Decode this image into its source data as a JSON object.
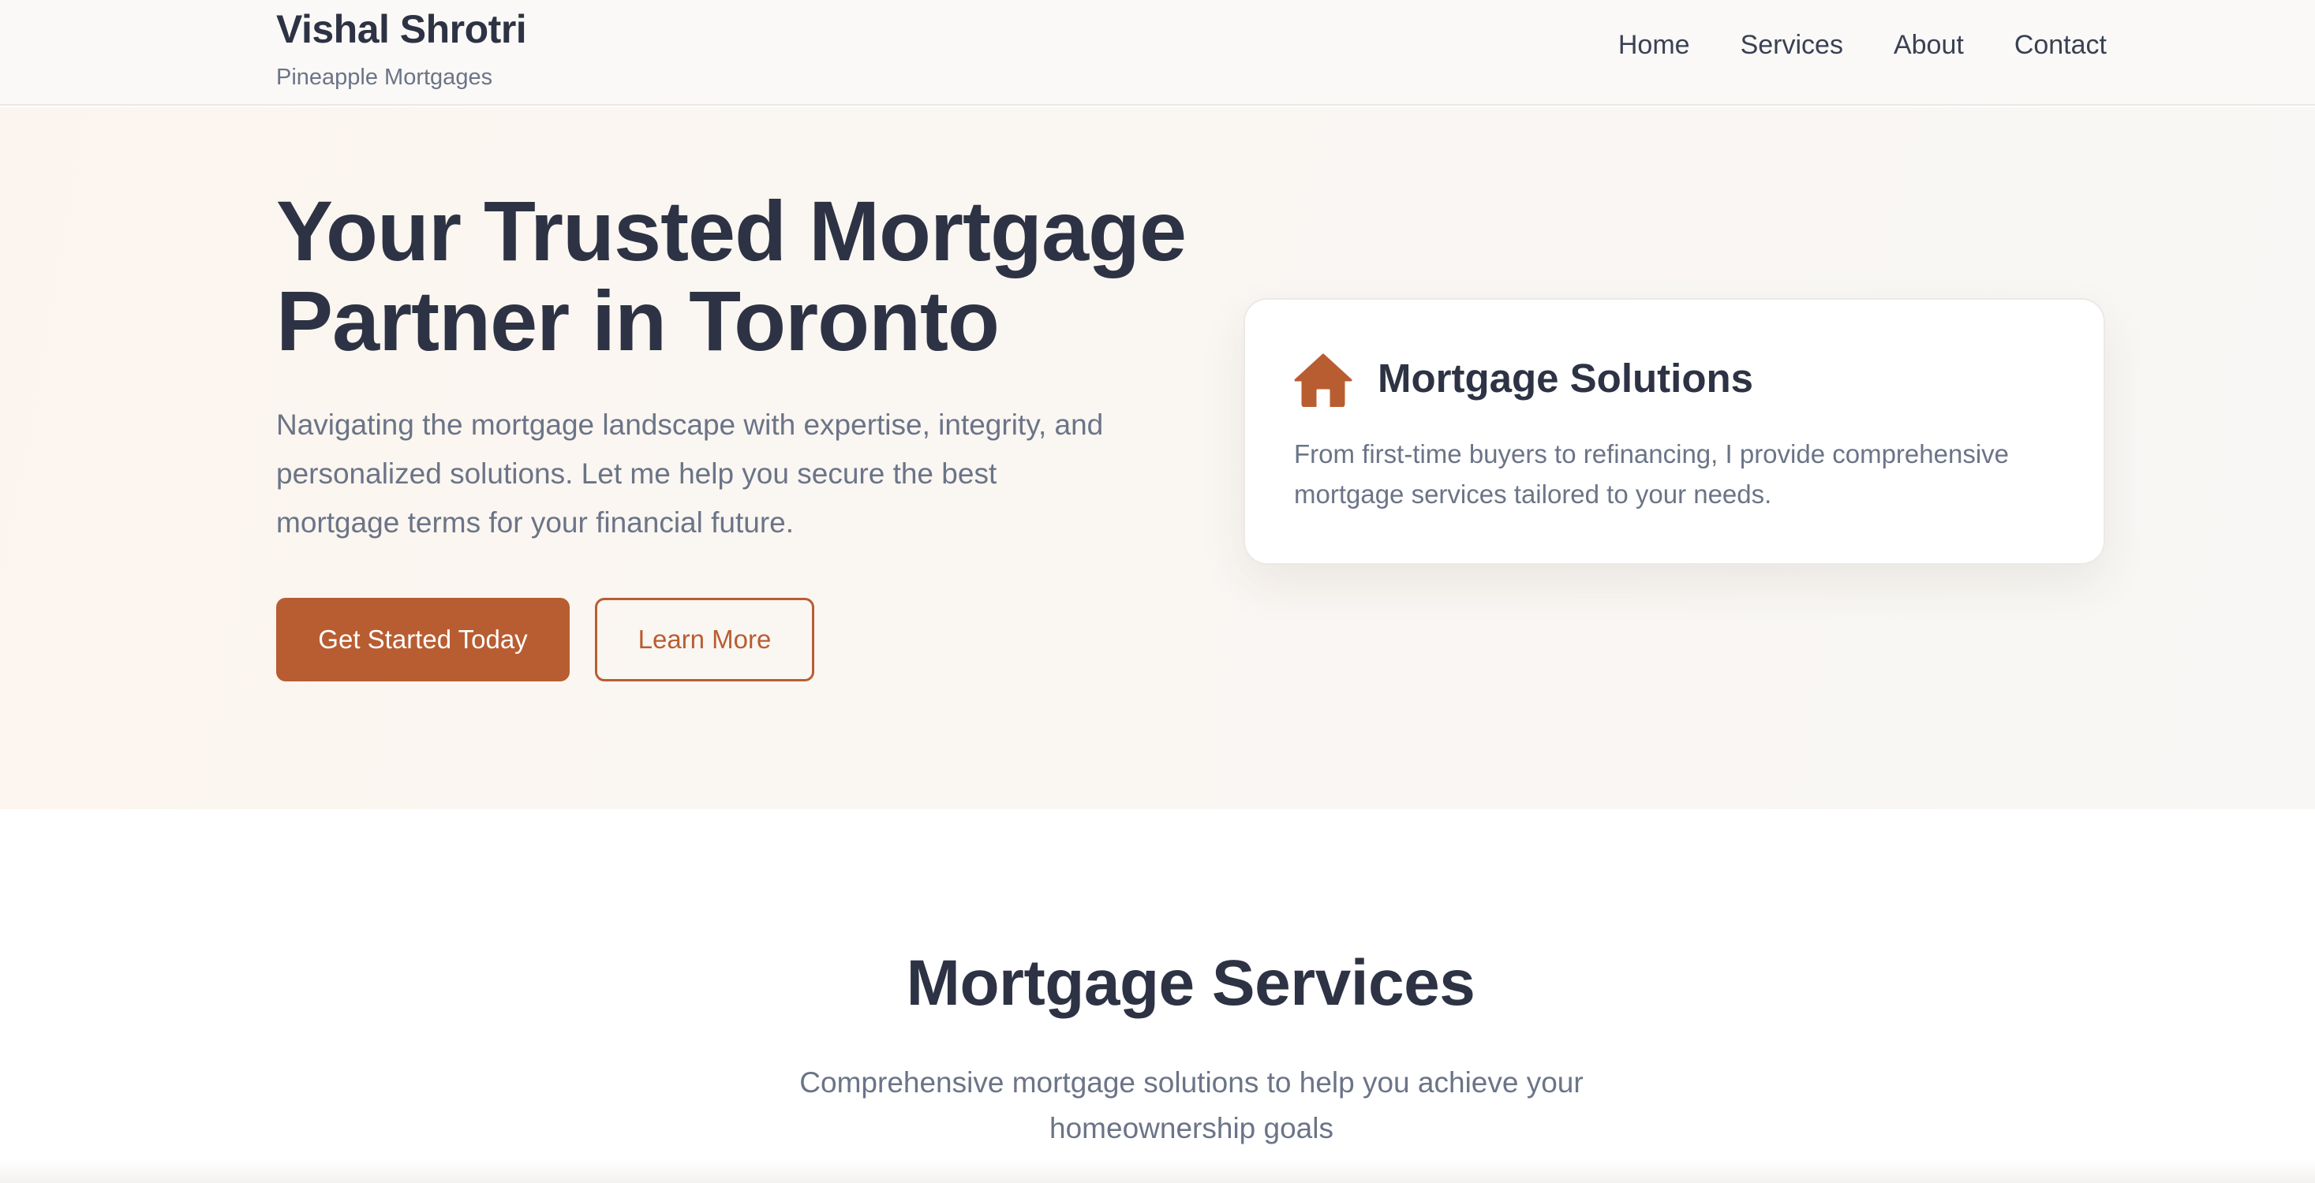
{
  "header": {
    "brand_name": "Vishal Shrotri",
    "brand_tagline": "Pineapple Mortgages",
    "nav": [
      {
        "label": "Home"
      },
      {
        "label": "Services"
      },
      {
        "label": "About"
      },
      {
        "label": "Contact"
      }
    ]
  },
  "hero": {
    "title_line1": "Your Trusted Mortgage",
    "title_line2": "Partner in Toronto",
    "description": "Navigating the mortgage landscape with expertise, integrity, and personalized solutions. Let me help you secure the best mortgage terms for your financial future.",
    "primary_button": "Get Started Today",
    "secondary_button": "Learn More",
    "card": {
      "icon": "house-icon",
      "title": "Mortgage Solutions",
      "text": "From first-time buyers to refinancing, I provide comprehensive mortgage services tailored to your needs."
    }
  },
  "services": {
    "title": "Mortgage Services",
    "subtitle": "Comprehensive mortgage solutions to help you achieve your homeownership goals"
  },
  "colors": {
    "accent": "#b85d32",
    "heading": "#2d3344",
    "muted_text": "#6b7487",
    "header_bg": "#faf9f7"
  }
}
